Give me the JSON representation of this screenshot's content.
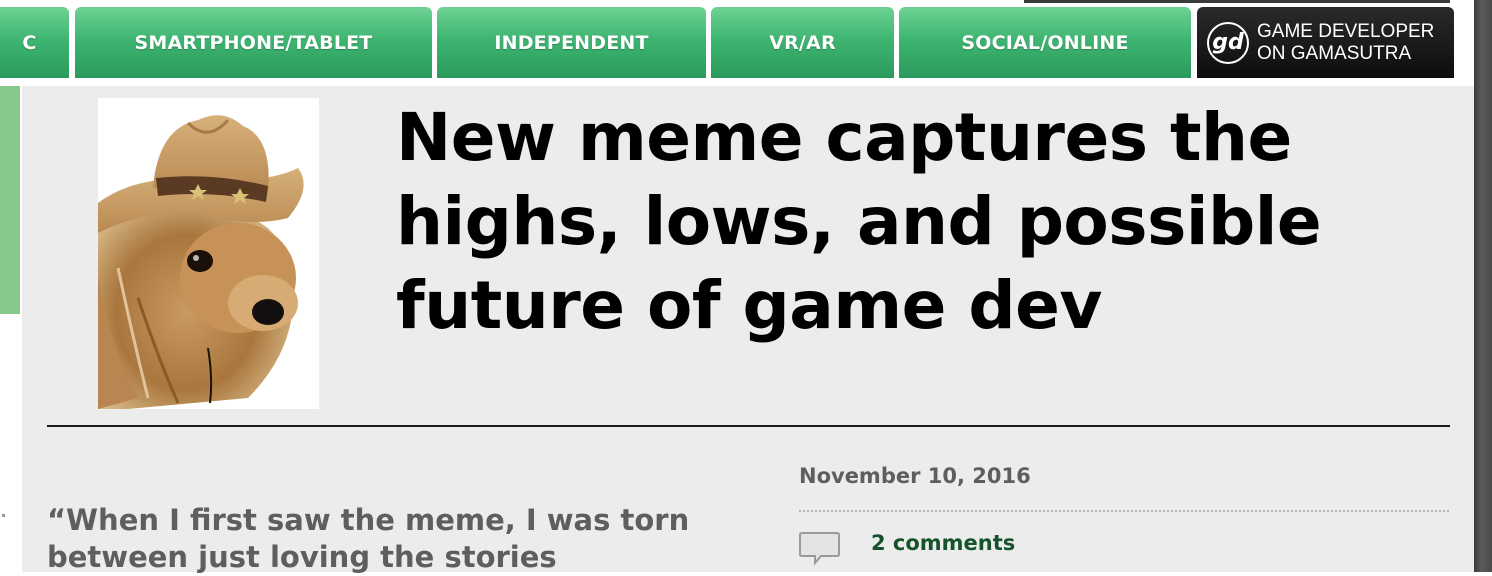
{
  "nav": {
    "tabs": [
      {
        "label": "C"
      },
      {
        "label": "SMARTPHONE/TABLET"
      },
      {
        "label": "INDEPENDENT"
      },
      {
        "label": "VR/AR"
      },
      {
        "label": "SOCIAL/ONLINE"
      }
    ],
    "brand": {
      "logo": "gd",
      "line1": "GAME DEVELOPER",
      "line2": "ON GAMASUTRA"
    }
  },
  "article": {
    "title": "New meme captures the highs, lows, and possible future of game dev",
    "thumbnail_icon": "dog-in-cowboy-hat-image",
    "pull_quote": "“When I first saw the meme, I was torn between just loving the stories",
    "date": "November 10, 2016",
    "comments": "2 comments"
  },
  "colors": {
    "nav_green": "#3fb572",
    "headline": "#000000",
    "comment_link": "#15532c"
  }
}
